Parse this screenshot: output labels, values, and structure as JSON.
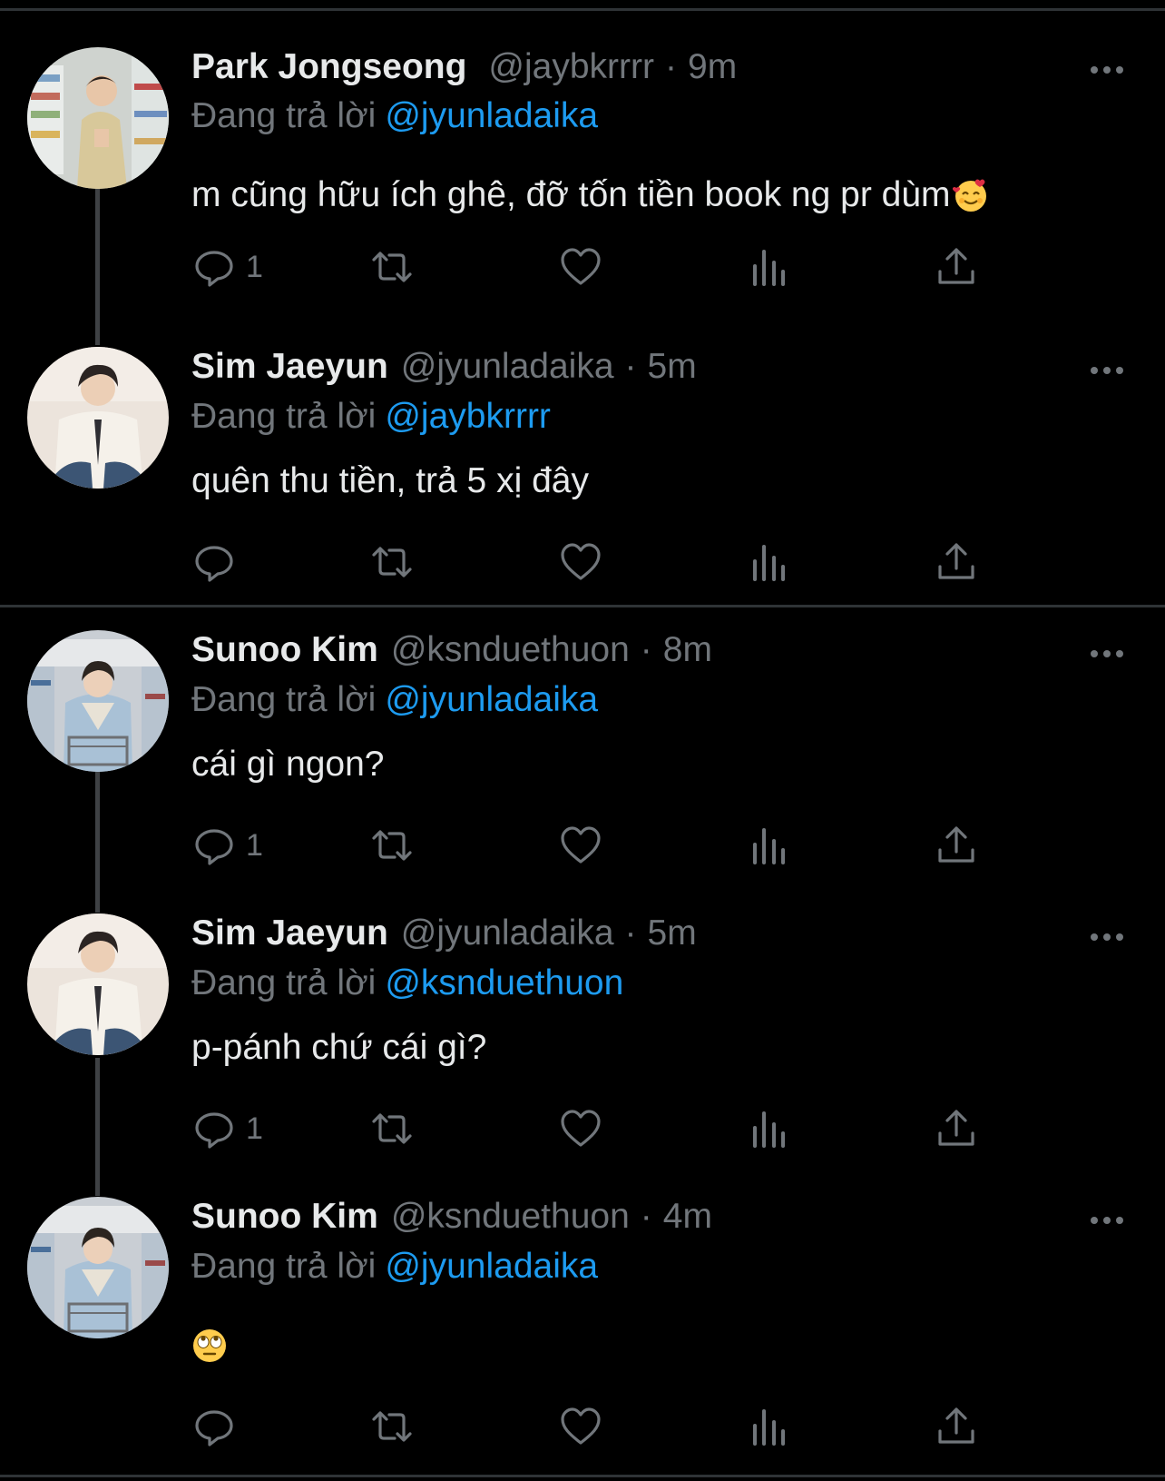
{
  "replying_label": "Đang trả lời",
  "tweets": [
    {
      "name": "Park Jongseong",
      "handle": "@jaybkrrrr",
      "time": "9m",
      "reply_to": "@jyunladaika",
      "text": "m cũng hữu ích ghê, đỡ tốn tiền book ng pr dùm",
      "emoji": "smiling-face-with-hearts",
      "reply_count": "1",
      "avatar": "avatar-park-jongseong"
    },
    {
      "name": "Sim Jaeyun",
      "handle": "@jyunladaika",
      "time": "5m",
      "reply_to": "@jaybkrrrr",
      "text": "quên thu tiền, trả 5 xị đây",
      "reply_count": "",
      "avatar": "avatar-sim-jaeyun"
    },
    {
      "name": "Sunoo Kim",
      "handle": "@ksnduethuon",
      "time": "8m",
      "reply_to": "@jyunladaika",
      "text": "cái gì ngon?",
      "reply_count": "1",
      "avatar": "avatar-sunoo-kim"
    },
    {
      "name": "Sim Jaeyun",
      "handle": "@jyunladaika",
      "time": "5m",
      "reply_to": "@ksnduethuon",
      "text": "p-pánh chứ cái gì?",
      "reply_count": "1",
      "avatar": "avatar-sim-jaeyun"
    },
    {
      "name": "Sunoo Kim",
      "handle": "@ksnduethuon",
      "time": "4m",
      "reply_to": "@jyunladaika",
      "text": "",
      "emoji": "face-with-rolling-eyes",
      "reply_count": "",
      "avatar": "avatar-sunoo-kim"
    }
  ],
  "colors": {
    "background": "#000000",
    "text": "#e7e9ea",
    "secondary": "#71767b",
    "mention": "#1d9bf0",
    "divider": "#2f3336",
    "thread_line": "#3e4144"
  },
  "icons": [
    "reply-icon",
    "retweet-icon",
    "like-icon",
    "analytics-icon",
    "share-icon",
    "more-icon"
  ]
}
